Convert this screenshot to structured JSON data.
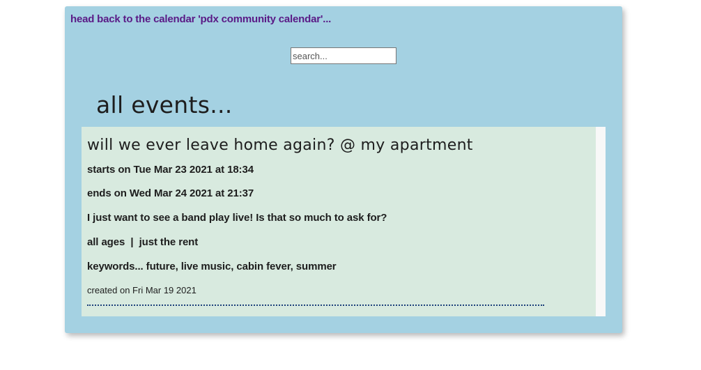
{
  "header": {
    "back_link": "head back to the calendar 'pdx community calendar'..."
  },
  "search": {
    "placeholder": "search..."
  },
  "main": {
    "title": "all events..."
  },
  "events": [
    {
      "title": "will we ever leave home again? @ my apartment",
      "starts": "starts on Tue Mar 23 2021 at 18:34",
      "ends": "ends on Wed Mar 24 2021 at 21:37",
      "description": "I just want to see a band play live! Is that so much to ask for?",
      "meta": "all ages  |  just the rent",
      "keywords": "keywords... future, live music, cabin fever, summer",
      "created": "created on Fri Mar 19 2021"
    }
  ],
  "colors": {
    "panel_bg": "#a4d1e2",
    "card_bg": "#d8eadf",
    "link": "#5a1a86",
    "divider": "#1b3f7a"
  }
}
